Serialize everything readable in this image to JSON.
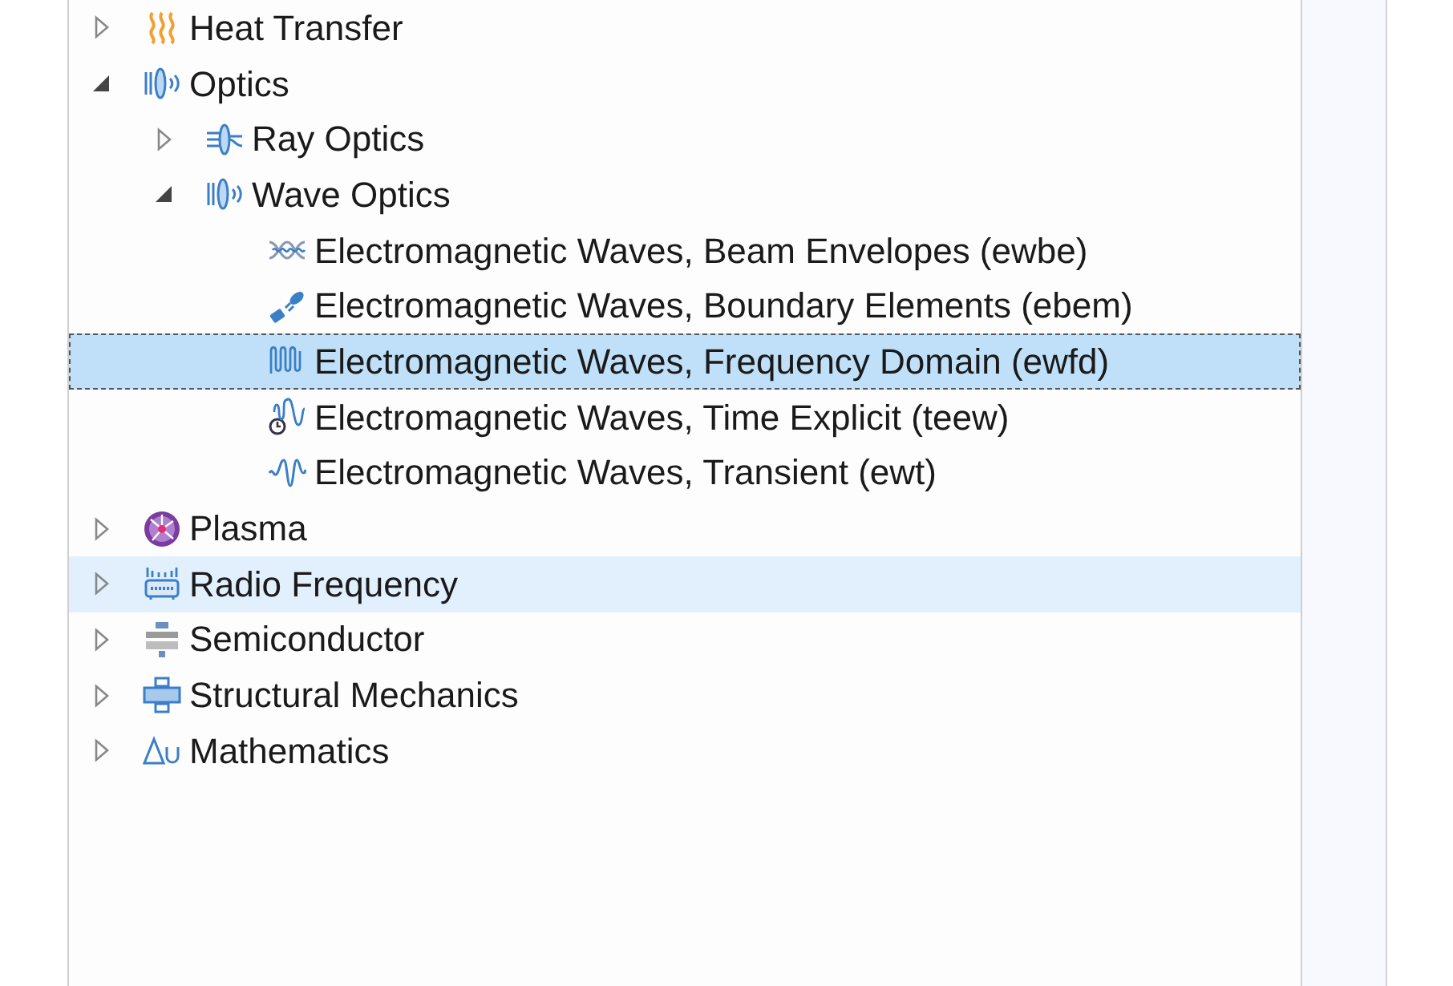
{
  "tree": [
    {
      "label": "Heat Transfer",
      "kind": "heat",
      "expanded": false,
      "selected": false,
      "hovered": false
    },
    {
      "label": "Optics",
      "kind": "optics",
      "expanded": true,
      "selected": false,
      "hovered": false,
      "children": [
        {
          "label": "Ray Optics",
          "kind": "ray",
          "expanded": false,
          "selected": false,
          "hovered": false
        },
        {
          "label": "Wave Optics",
          "kind": "optics",
          "expanded": true,
          "selected": false,
          "hovered": false,
          "children": [
            {
              "label": "Electromagnetic Waves, Beam Envelopes (ewbe)",
              "kind": "beam",
              "selected": false,
              "hovered": false
            },
            {
              "label": "Electromagnetic Waves, Boundary Elements (ebem)",
              "kind": "boundary",
              "selected": false,
              "hovered": false
            },
            {
              "label": "Electromagnetic Waves, Frequency Domain (ewfd)",
              "kind": "freq",
              "selected": true,
              "hovered": false
            },
            {
              "label": "Electromagnetic Waves, Time Explicit (teew)",
              "kind": "time",
              "selected": false,
              "hovered": false
            },
            {
              "label": "Electromagnetic Waves, Transient (ewt)",
              "kind": "transient",
              "selected": false,
              "hovered": false
            }
          ]
        }
      ]
    },
    {
      "label": "Plasma",
      "kind": "plasma",
      "expanded": false,
      "selected": false,
      "hovered": false
    },
    {
      "label": "Radio Frequency",
      "kind": "rf",
      "expanded": false,
      "selected": false,
      "hovered": true
    },
    {
      "label": "Semiconductor",
      "kind": "semi",
      "expanded": false,
      "selected": false,
      "hovered": false
    },
    {
      "label": "Structural Mechanics",
      "kind": "struct",
      "expanded": false,
      "selected": false,
      "hovered": false
    },
    {
      "label": "Mathematics",
      "kind": "math",
      "expanded": false,
      "selected": false,
      "hovered": false
    }
  ]
}
